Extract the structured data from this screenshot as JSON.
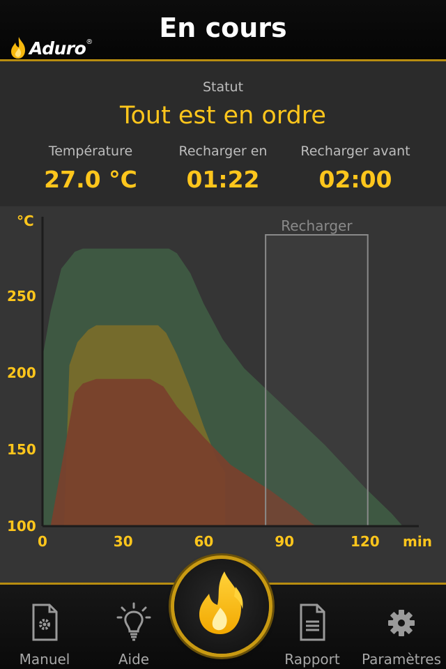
{
  "header": {
    "title": "En cours",
    "logo_text": "Aduro",
    "logo_reg": "®"
  },
  "status": {
    "label": "Statut",
    "value": "Tout est en ordre",
    "metrics": [
      {
        "label": "Température",
        "value": "27.0 °C"
      },
      {
        "label": "Recharger en",
        "value": "01:22"
      },
      {
        "label": "Recharger avant",
        "value": "02:00"
      }
    ]
  },
  "chart_data": {
    "type": "area",
    "ylabel": "°C",
    "xlabel": "min",
    "xlim": [
      0,
      140
    ],
    "ylim": [
      100,
      300
    ],
    "x_ticks": [
      0,
      30,
      60,
      90,
      120
    ],
    "y_ticks": [
      100,
      150,
      200,
      250
    ],
    "annotation": {
      "label": "Recharger",
      "x_start": 83,
      "x_end": 121,
      "y_top": 290
    },
    "series": [
      {
        "color": "#3f5b43",
        "points": [
          [
            0,
            210
          ],
          [
            3,
            240
          ],
          [
            7,
            268
          ],
          [
            12,
            279
          ],
          [
            15,
            281
          ],
          [
            47,
            281
          ],
          [
            50,
            278
          ],
          [
            55,
            265
          ],
          [
            60,
            245
          ],
          [
            67,
            222
          ],
          [
            75,
            203
          ],
          [
            90,
            178
          ],
          [
            105,
            153
          ],
          [
            120,
            125
          ],
          [
            130,
            108
          ],
          [
            134,
            100
          ]
        ]
      },
      {
        "color": "#7a6c2a",
        "points": [
          [
            8,
            100
          ],
          [
            10,
            205
          ],
          [
            13,
            220
          ],
          [
            17,
            228
          ],
          [
            20,
            231
          ],
          [
            43,
            231
          ],
          [
            46,
            226
          ],
          [
            50,
            212
          ],
          [
            55,
            190
          ],
          [
            60,
            165
          ],
          [
            65,
            143
          ],
          [
            68,
            135
          ]
        ]
      },
      {
        "color": "#79402c",
        "points": [
          [
            0,
            100
          ],
          [
            3,
            100
          ],
          [
            12,
            187
          ],
          [
            15,
            193
          ],
          [
            20,
            196
          ],
          [
            40,
            196
          ],
          [
            45,
            191
          ],
          [
            50,
            178
          ],
          [
            60,
            158
          ],
          [
            70,
            140
          ],
          [
            85,
            123
          ],
          [
            95,
            110
          ],
          [
            100,
            102
          ],
          [
            102,
            100
          ]
        ]
      }
    ]
  },
  "tabbar": {
    "tabs": [
      {
        "label": "Manuel",
        "icon": "document-gear-icon"
      },
      {
        "label": "Aide",
        "icon": "lightbulb-icon"
      },
      {
        "label": "Rapport",
        "icon": "document-lines-icon"
      },
      {
        "label": "Paramètres",
        "icon": "gear-icon"
      }
    ],
    "center_icon": "flame-icon"
  },
  "colors": {
    "accent": "#ffc61c",
    "gold": "#b88d10",
    "background": "#2b2b2b"
  }
}
